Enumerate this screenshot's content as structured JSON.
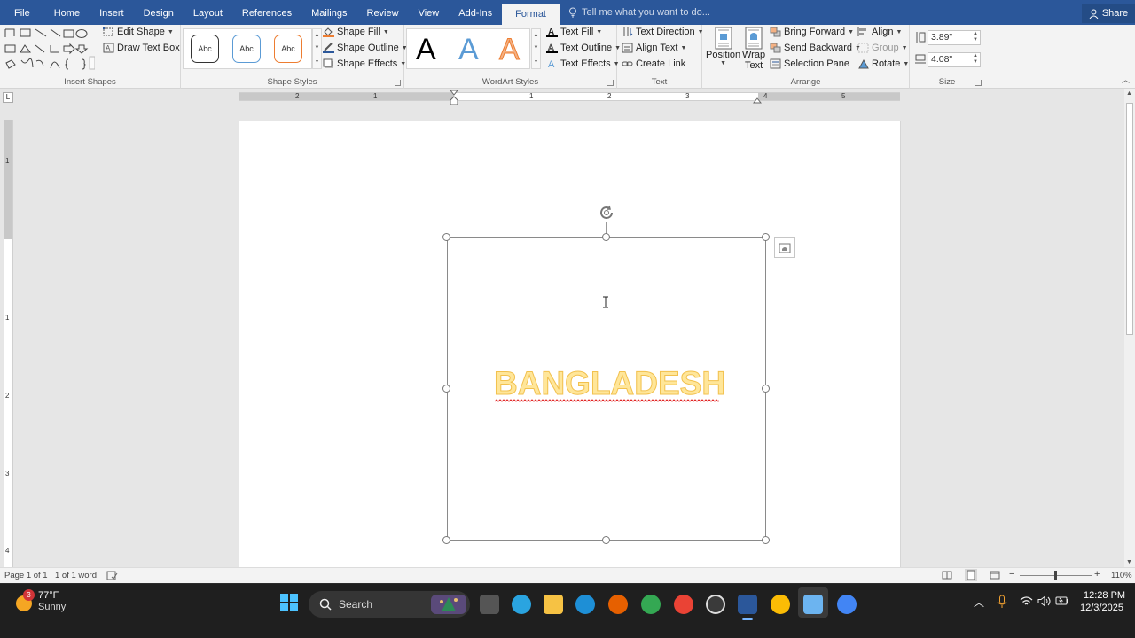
{
  "tabs": [
    "File",
    "Home",
    "Insert",
    "Design",
    "Layout",
    "References",
    "Mailings",
    "Review",
    "View",
    "Add-Ins",
    "Format"
  ],
  "active_tab": "Format",
  "tell_me": "Tell me what you want to do...",
  "share": "Share",
  "ribbon": {
    "insert_shapes": {
      "label": "Insert Shapes",
      "edit_shape": "Edit Shape",
      "draw_text_box": "Draw Text Box"
    },
    "shape_styles": {
      "label": "Shape Styles",
      "sample": "Abc",
      "shape_fill": "Shape Fill",
      "shape_outline": "Shape Outline",
      "shape_effects": "Shape Effects"
    },
    "wordart_styles": {
      "label": "WordArt Styles",
      "sample": "A",
      "text_fill": "Text Fill",
      "text_outline": "Text Outline",
      "text_effects": "Text Effects"
    },
    "text": {
      "label": "Text",
      "text_direction": "Text Direction",
      "align_text": "Align Text",
      "create_link": "Create Link"
    },
    "arrange": {
      "label": "Arrange",
      "position": "Position",
      "wrap_text_1": "Wrap",
      "wrap_text_2": "Text",
      "bring_forward": "Bring Forward",
      "send_backward": "Send Backward",
      "selection_pane": "Selection Pane",
      "align": "Align",
      "group": "Group",
      "rotate": "Rotate"
    },
    "size": {
      "label": "Size",
      "height": "3.89\"",
      "width": "4.08\""
    }
  },
  "ruler": {
    "h_numbers": [
      "2",
      "1",
      "1",
      "2",
      "3",
      "4",
      "5"
    ],
    "v_numbers": [
      "1",
      "1",
      "2",
      "3",
      "4"
    ],
    "tab_selector": "L"
  },
  "document": {
    "wordart_text": "BANGLADESH"
  },
  "status": {
    "page": "Page 1 of 1",
    "words": "1 of 1 word",
    "zoom": "110%"
  },
  "taskbar": {
    "weather_temp": "77°F",
    "weather_desc": "Sunny",
    "weather_badge": "3",
    "search": "Search",
    "time": "12:28 PM",
    "date": "12/3/2025"
  }
}
